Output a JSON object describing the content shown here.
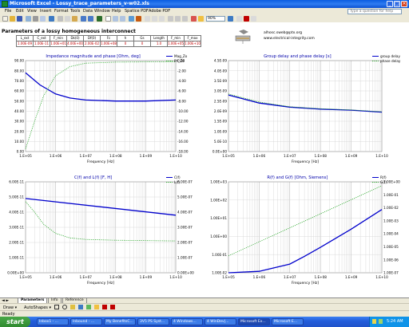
{
  "window": {
    "title": "Microsoft Excel - Lossy_trace_parameters_v-w02.xls",
    "minimize": "_",
    "maximize": "□",
    "close": "×"
  },
  "menu": {
    "items": [
      "File",
      "Edit",
      "View",
      "Insert",
      "Format",
      "Tools",
      "Data",
      "Window",
      "Help",
      "Spatice PDF",
      "Adobe PDF"
    ],
    "help_placeholder": "Type a question for help"
  },
  "toolbar": {
    "zoom": "90%"
  },
  "sheet": {
    "title": "Parameters of a lossy homogeneous interconnect",
    "param_headers": [
      "L_ext",
      "C_ext",
      "F_min",
      "Dk(0)",
      "Df(0)",
      "Fc",
      "h",
      "Gs",
      "Length",
      "F_min",
      "F_max"
    ],
    "param_values": [
      "1.00E-09",
      "1.00E-11",
      "1.00E+01",
      "4.00E+00",
      "2.00E-02",
      "1.00E+08",
      "0",
      "0",
      "1.0",
      "1.00E+05",
      "1.00E+10"
    ],
    "contact_email": "alhosc.sweb@ptx.org",
    "contact_site": "www.electrical-integrity.com"
  },
  "charts": [
    {
      "title": "Impedance magnitude and phase [Ohm, deg]",
      "xlabel": "Frequency [Hz]",
      "series_names": [
        "Mag_Zo",
        "Ph_Zo"
      ],
      "left_ticks": [
        "0.00",
        "10.00",
        "20.00",
        "30.00",
        "40.00",
        "50.00",
        "60.00",
        "70.00",
        "80.00",
        "90.00"
      ],
      "right_ticks": [
        "-18.00",
        "-16.00",
        "-14.00",
        "-12.00",
        "-10.00",
        "-8.00",
        "-6.00",
        "-4.00",
        "-2.00",
        "0.00"
      ],
      "x_ticks": [
        "1.E+05",
        "1.E+06",
        "1.E+07",
        "1.E+08",
        "1.E+09",
        "1.E+10"
      ]
    },
    {
      "title": "Group delay and phase delay [s]",
      "xlabel": "Frequency [Hz]",
      "series_names": [
        "group delay",
        "phase delay"
      ],
      "left_ticks": [
        "0.0E+00",
        "5.0E-10",
        "1.0E-09",
        "1.5E-09",
        "2.0E-09",
        "2.5E-09",
        "3.0E-09",
        "3.5E-09",
        "4.0E-09",
        "4.5E-09"
      ],
      "x_ticks": [
        "1.E+05",
        "1.E+06",
        "1.E+07",
        "1.E+08",
        "1.E+09",
        "1.E+10"
      ]
    },
    {
      "title": "C(f) and L(f) [F, H]",
      "xlabel": "Frequency [Hz]",
      "series_names": [
        "C(f)",
        "L(f)"
      ],
      "left_ticks": [
        "0.00E+00",
        "1.00E-11",
        "2.00E-11",
        "3.00E-11",
        "4.00E-11",
        "5.00E-11",
        "6.00E-11"
      ],
      "right_ticks": [
        "0.00E+00",
        "1.00E-07",
        "2.00E-07",
        "3.00E-07",
        "4.00E-07",
        "5.00E-07",
        "6.00E-07"
      ],
      "x_ticks": [
        "1.E+05",
        "1.E+06",
        "1.E+07",
        "1.E+08",
        "1.E+09",
        "1.E+10"
      ]
    },
    {
      "title": "R(f) and G(f) [Ohm, Siemens]",
      "xlabel": "Frequency [Hz]",
      "series_names": [
        "R(f)",
        "G(f)"
      ],
      "left_ticks": [
        "1.00E-02",
        "1.00E-01",
        "1.00E+00",
        "1.00E+01",
        "1.00E+02",
        "1.00E+03"
      ],
      "right_ticks": [
        "1.00E-07",
        "1.00E-06",
        "1.00E-05",
        "1.00E-04",
        "1.00E-03",
        "1.00E-02",
        "1.00E-01",
        "1.00E+00"
      ],
      "x_ticks": [
        "1.E+05",
        "1.E+06",
        "1.E+07",
        "1.E+08",
        "1.E+09",
        "1.E+10"
      ]
    }
  ],
  "chart_data": [
    {
      "type": "line",
      "title": "Impedance magnitude and phase [Ohm, deg]",
      "xlabel": "Frequency [Hz]",
      "log_x": true,
      "xlim": [
        100000,
        10000000000
      ],
      "ylim": [
        0,
        90
      ],
      "ylim_right": [
        -18,
        0
      ],
      "series": [
        {
          "name": "Mag_Zo",
          "axis": "left",
          "color": "#0000cc",
          "style": "solid",
          "x": [
            100000,
            300000,
            1000000,
            3000000,
            10000000,
            100000000,
            1000000000,
            10000000000
          ],
          "y": [
            78,
            66,
            57,
            53,
            51,
            50,
            50,
            51
          ]
        },
        {
          "name": "Ph_Zo",
          "axis": "right",
          "color": "#33aa33",
          "style": "dotted",
          "x": [
            100000,
            200000,
            400000,
            1000000,
            3000000,
            10000000,
            100000000,
            10000000000
          ],
          "y": [
            -17.5,
            -12,
            -7,
            -3,
            -1.2,
            -0.5,
            -0.3,
            -0.2
          ]
        }
      ]
    },
    {
      "type": "line",
      "title": "Group delay and phase delay [s]",
      "xlabel": "Frequency [Hz]",
      "log_x": true,
      "xlim": [
        100000,
        10000000000
      ],
      "ylim": [
        0,
        4.5e-09
      ],
      "series": [
        {
          "name": "group delay",
          "color": "#0000cc",
          "style": "solid",
          "x": [
            100000,
            1000000,
            10000000,
            100000000,
            1000000000,
            10000000000
          ],
          "y": [
            2.8e-09,
            2.4e-09,
            2.2e-09,
            2.1e-09,
            2.05e-09,
            1.95e-09
          ]
        },
        {
          "name": "phase delay",
          "color": "#33aa33",
          "style": "dotted",
          "x": [
            100000,
            1000000,
            10000000,
            100000000,
            1000000000,
            10000000000
          ],
          "y": [
            2.85e-09,
            2.45e-09,
            2.22e-09,
            2.12e-09,
            2.06e-09,
            1.97e-09
          ]
        }
      ]
    },
    {
      "type": "line",
      "title": "C(f) and L(f) [F, H]",
      "xlabel": "Frequency [Hz]",
      "log_x": true,
      "xlim": [
        100000,
        10000000000
      ],
      "ylim": [
        0,
        6e-11
      ],
      "ylim_right": [
        0,
        6e-07
      ],
      "series": [
        {
          "name": "C(f)",
          "axis": "left",
          "color": "#0000cc",
          "style": "solid",
          "x": [
            100000,
            10000000000
          ],
          "y": [
            4.9e-11,
            3.8e-11
          ]
        },
        {
          "name": "L(f)",
          "axis": "right",
          "color": "#33aa33",
          "style": "dotted",
          "x": [
            100000,
            200000,
            400000,
            1000000,
            3000000,
            10000000,
            100000000,
            10000000000
          ],
          "y": [
            4.7e-07,
            4e-07,
            3.2e-07,
            2.6e-07,
            2.3e-07,
            2.2e-07,
            2.15e-07,
            2.1e-07
          ]
        }
      ]
    },
    {
      "type": "line",
      "title": "R(f) and G(f) [Ohm, Siemens]",
      "xlabel": "Frequency [Hz]",
      "log_x": true,
      "log_y": true,
      "xlim": [
        100000,
        10000000000
      ],
      "ylim": [
        0.01,
        1000
      ],
      "ylim_right": [
        1e-07,
        1
      ],
      "series": [
        {
          "name": "R(f)",
          "axis": "left",
          "color": "#0000cc",
          "style": "solid",
          "x": [
            100000,
            1000000,
            10000000,
            30000000,
            100000000,
            1000000000,
            10000000000
          ],
          "y": [
            0.01,
            0.012,
            0.03,
            0.08,
            0.25,
            2.5,
            30
          ]
        },
        {
          "name": "G(f)",
          "axis": "right",
          "color": "#33aa33",
          "style": "dotted",
          "x": [
            100000,
            10000000000
          ],
          "y": [
            2e-06,
            0.5
          ]
        }
      ]
    }
  ],
  "tabs": [
    "Parameters",
    "Info",
    "Reference"
  ],
  "drawbar": {
    "draw": "Draw ▾",
    "autoshapes": "AutoShapes ▾"
  },
  "statusbar": {
    "text": "Ready"
  },
  "taskbar": {
    "start": "start",
    "tasks": [
      "Inbox1 - ...",
      "Inbound - ...",
      "My BenefitsC...",
      "3V5 PS Syst...",
      "4 Windows...",
      "4 WinDev|...",
      "Microsoft Ex...",
      "Microsoft E..."
    ],
    "clock": "5:24 AM"
  },
  "colors": {
    "series_primary": "#0000cc",
    "series_secondary": "#33aa33",
    "param_value": "#c00000",
    "titlebar": "#0a5ce0"
  }
}
